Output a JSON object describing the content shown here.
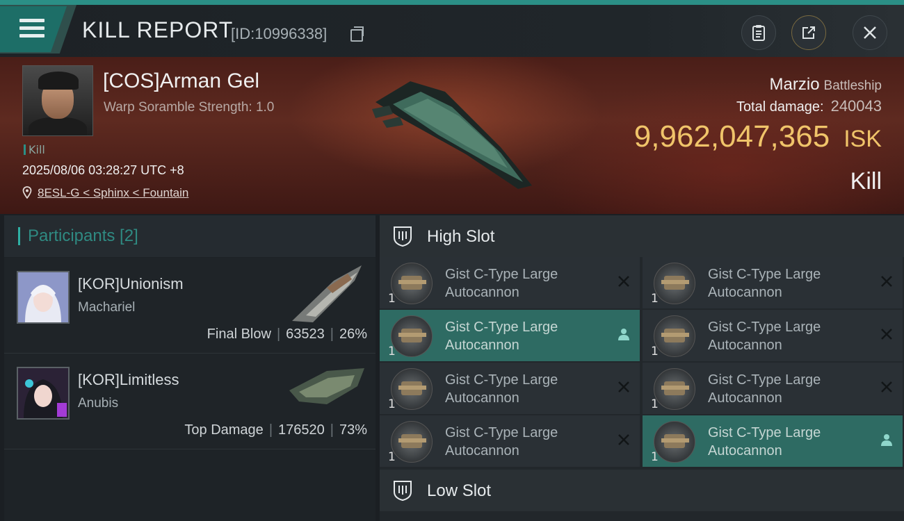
{
  "header": {
    "title": "KILL REPORT",
    "report_id": "[ID:10996338]"
  },
  "victim": {
    "name": "[COS]Arman Gel",
    "scramble": "Warp Soramble Strength: 1.0",
    "kill_tag": "Kill",
    "datetime": "2025/08/06 03:28:27 UTC +8",
    "location": "8ESL-G < Sphinx < Fountain",
    "ship": "Marzio",
    "ship_class": "Battleship",
    "total_damage_label": "Total damage:",
    "total_damage": "240043",
    "isk_value": "9,962,047,365",
    "isk_unit": "ISK",
    "result": "Kill"
  },
  "participants": {
    "title": "Participants [2]",
    "rows": [
      {
        "name": "[KOR]Unionism",
        "ship": "Machariel",
        "role": "Final Blow",
        "damage": "63523",
        "percent": "26%"
      },
      {
        "name": "[KOR]Limitless",
        "ship": "Anubis",
        "role": "Top Damage",
        "damage": "176520",
        "percent": "73%"
      }
    ]
  },
  "slots": {
    "high_label": "High Slot",
    "low_label": "Low Slot",
    "modules": [
      {
        "name": "Gist C-Type Large Autocannon",
        "qty": "1",
        "state": "destroyed"
      },
      {
        "name": "Gist C-Type Large Autocannon",
        "qty": "1",
        "state": "destroyed"
      },
      {
        "name": "Gist C-Type Large Autocannon",
        "qty": "1",
        "state": "dropped"
      },
      {
        "name": "Gist C-Type Large Autocannon",
        "qty": "1",
        "state": "destroyed"
      },
      {
        "name": "Gist C-Type Large Autocannon",
        "qty": "1",
        "state": "destroyed"
      },
      {
        "name": "Gist C-Type Large Autocannon",
        "qty": "1",
        "state": "destroyed"
      },
      {
        "name": "Gist C-Type Large Autocannon",
        "qty": "1",
        "state": "destroyed"
      },
      {
        "name": "Gist C-Type Large Autocannon",
        "qty": "1",
        "state": "dropped"
      }
    ]
  },
  "colors": {
    "accent": "#2b8f86",
    "isk": "#f0c46a",
    "active_row": "#2e6b63"
  },
  "icons": {
    "menu": "hamburger-icon",
    "copy": "copy-icon",
    "clipboard": "clipboard-icon",
    "share": "share-icon",
    "close": "close-icon",
    "location": "pin-icon",
    "slot": "shield-icon",
    "destroyed": "x-icon",
    "dropped": "person-icon"
  }
}
